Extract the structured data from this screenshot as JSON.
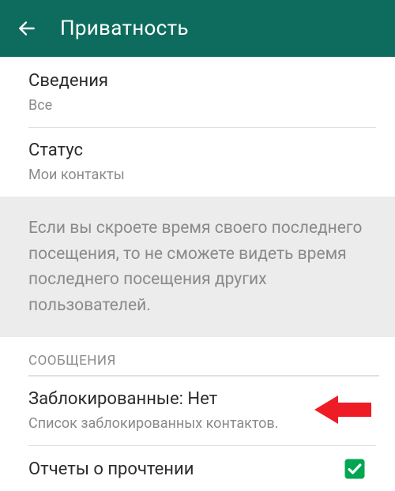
{
  "colors": {
    "brand": "#0e6c5e",
    "accent": "#00a651",
    "annotation": "#ee1c25"
  },
  "header": {
    "title": "Приватность"
  },
  "items": {
    "about": {
      "title": "Сведения",
      "subtitle": "Все"
    },
    "status": {
      "title": "Статус",
      "subtitle": "Мои контакты"
    }
  },
  "info_note": "Если вы скроете время своего последнего посещения, то не сможете видеть время последнего посещения других пользователей.",
  "section_messages": "СООБЩЕНИЯ",
  "blocked": {
    "title": "Заблокированные: Нет",
    "subtitle": "Список заблокированных контактов."
  },
  "read_receipts": {
    "title": "Отчеты о прочтении",
    "checked": true
  }
}
